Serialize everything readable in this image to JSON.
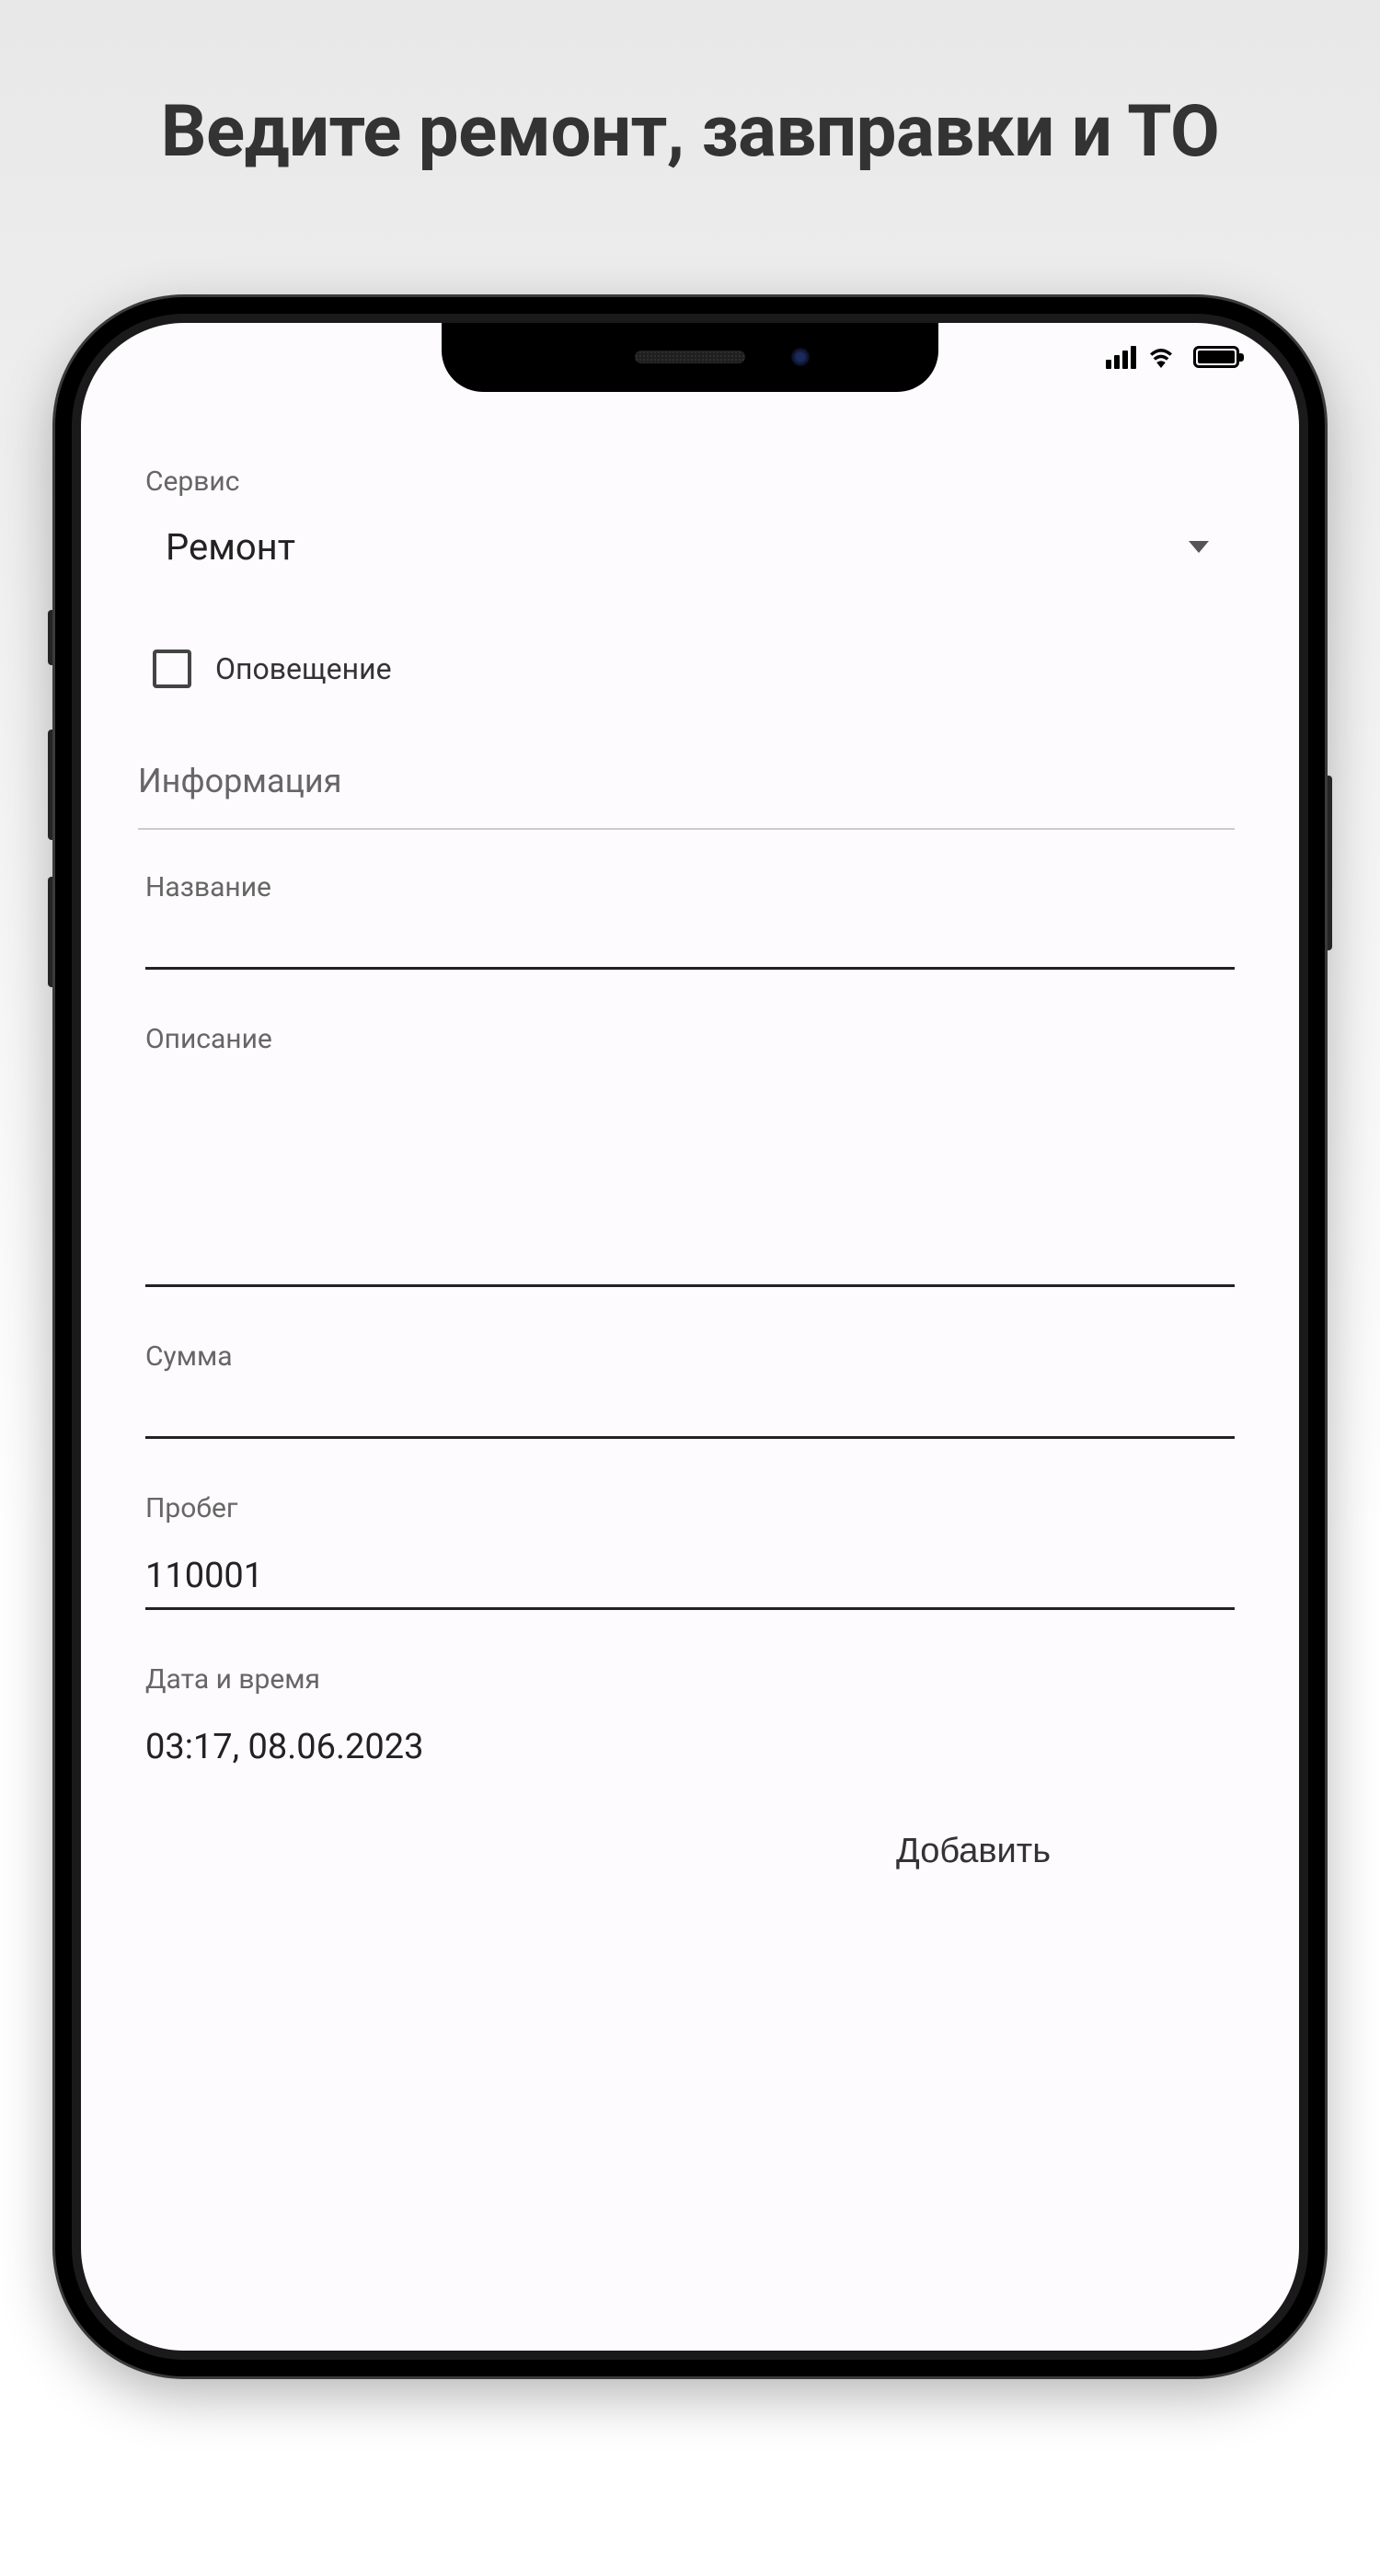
{
  "page": {
    "title": "Ведите ремонт, завправки и ТО"
  },
  "form": {
    "service": {
      "label": "Сервис",
      "value": "Ремонт"
    },
    "notification": {
      "label": "Оповещение",
      "checked": false
    },
    "section_title": "Информация",
    "name": {
      "label": "Название",
      "value": ""
    },
    "description": {
      "label": "Описание",
      "value": ""
    },
    "amount": {
      "label": "Сумма",
      "value": ""
    },
    "mileage": {
      "label": "Пробег",
      "value": "110001"
    },
    "datetime": {
      "label": "Дата и время",
      "value": "03:17, 08.06.2023"
    },
    "submit_label": "Добавить"
  }
}
